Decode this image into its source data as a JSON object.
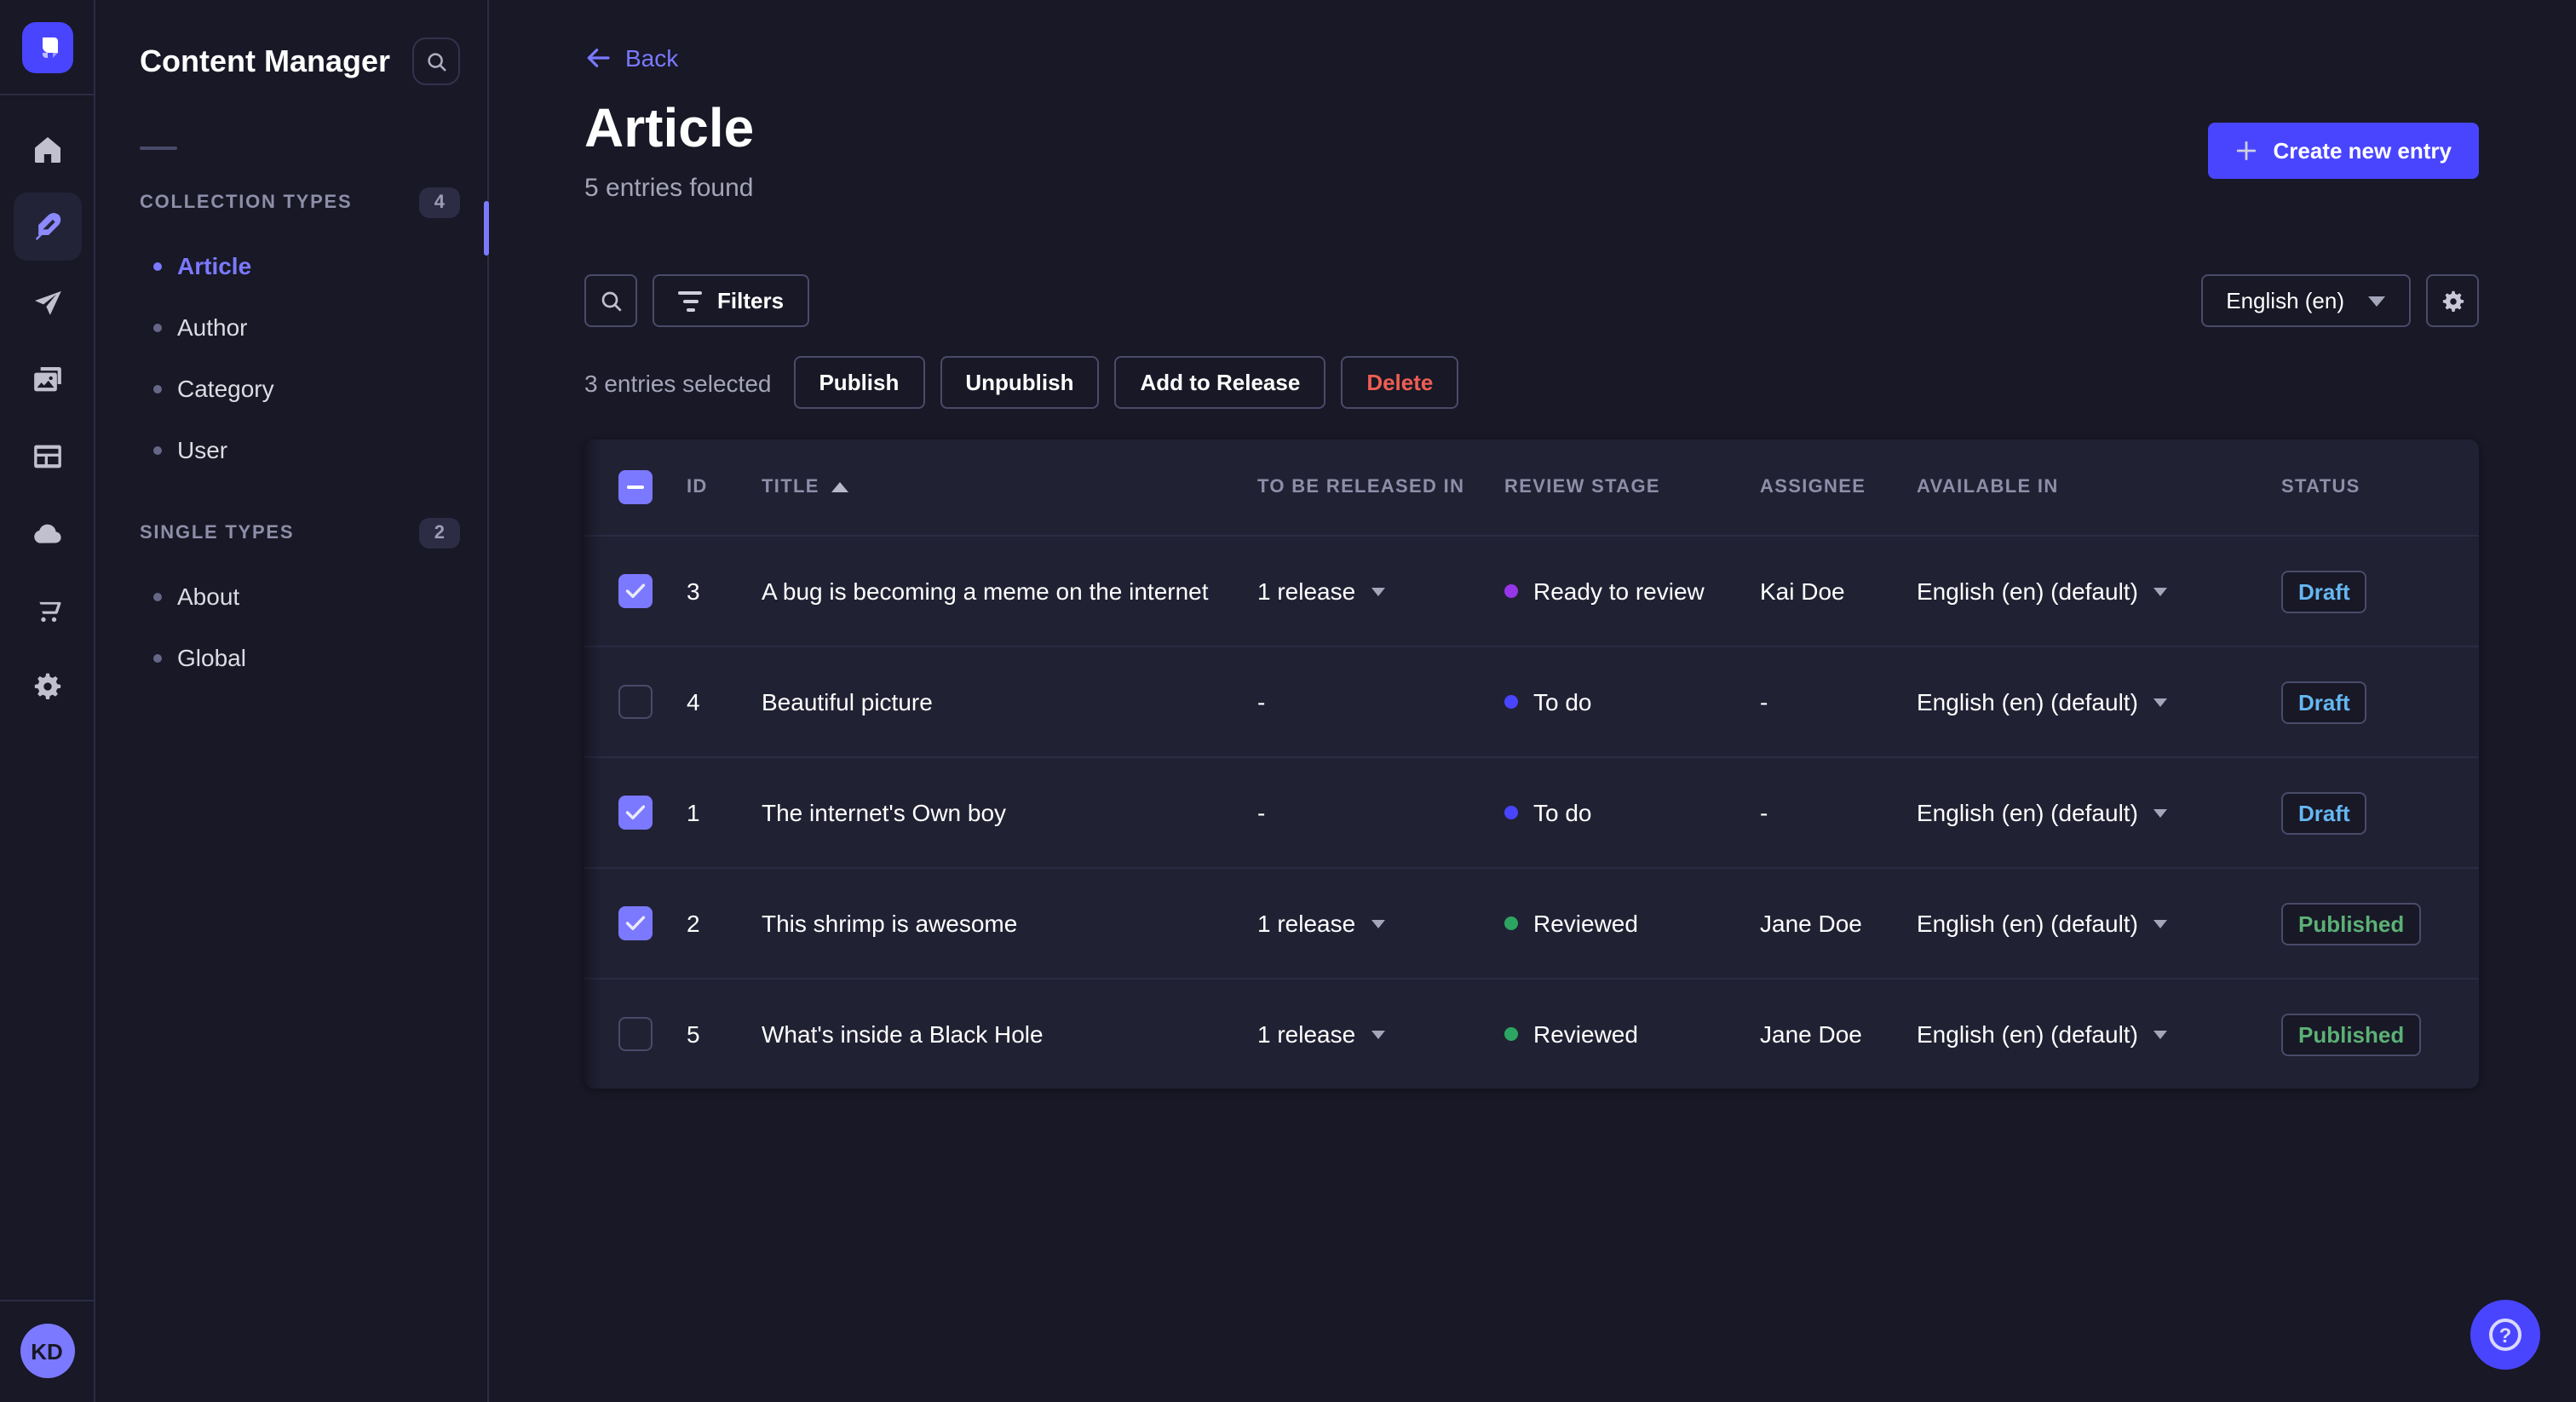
{
  "nav_rail": {
    "items": [
      {
        "name": "home-icon"
      },
      {
        "name": "content-manager-feather-icon",
        "active": true
      },
      {
        "name": "releases-paper-plane-icon"
      },
      {
        "name": "media-library-images-icon"
      },
      {
        "name": "content-type-builder-layout-icon"
      },
      {
        "name": "cloud-icon"
      },
      {
        "name": "marketplace-cart-icon"
      },
      {
        "name": "settings-gear-icon"
      }
    ],
    "avatar_initials": "KD"
  },
  "sidebar": {
    "title": "Content Manager",
    "sections": [
      {
        "label": "COLLECTION TYPES",
        "count": "4",
        "items": [
          {
            "label": "Article",
            "active": true
          },
          {
            "label": "Author",
            "active": false
          },
          {
            "label": "Category",
            "active": false
          },
          {
            "label": "User",
            "active": false
          }
        ]
      },
      {
        "label": "SINGLE TYPES",
        "count": "2",
        "items": [
          {
            "label": "About",
            "active": false
          },
          {
            "label": "Global",
            "active": false
          }
        ]
      }
    ]
  },
  "header": {
    "back_label": "Back",
    "title": "Article",
    "subtitle": "5 entries found",
    "create_button_label": "Create new entry"
  },
  "toolbar": {
    "filters_label": "Filters",
    "locale_selector": "English (en)"
  },
  "selection": {
    "text": "3 entries selected",
    "publish_label": "Publish",
    "unpublish_label": "Unpublish",
    "add_to_release_label": "Add to Release",
    "delete_label": "Delete"
  },
  "table": {
    "columns": {
      "id": "ID",
      "title": "TITLE",
      "to_be_released_in": "TO BE RELEASED IN",
      "review_stage": "REVIEW STAGE",
      "assignee": "ASSIGNEE",
      "available_in": "AVAILABLE IN",
      "status": "STATUS"
    },
    "sorted_column": "TITLE",
    "rows": [
      {
        "selected": true,
        "id": "3",
        "title": "A bug is becoming a meme on the internet",
        "release": "1 release",
        "has_release_caret": true,
        "stage": "Ready to review",
        "stage_color": "#9736e8",
        "assignee": "Kai Doe",
        "locale": "English (en) (default)",
        "status": "Draft",
        "status_color": "#66b7f1"
      },
      {
        "selected": false,
        "id": "4",
        "title": "Beautiful picture",
        "release": "-",
        "has_release_caret": false,
        "stage": "To do",
        "stage_color": "#4945ff",
        "assignee": "-",
        "locale": "English (en) (default)",
        "status": "Draft",
        "status_color": "#66b7f1"
      },
      {
        "selected": true,
        "id": "1",
        "title": "The internet's Own boy",
        "release": "-",
        "has_release_caret": false,
        "stage": "To do",
        "stage_color": "#4945ff",
        "assignee": "-",
        "locale": "English (en) (default)",
        "status": "Draft",
        "status_color": "#66b7f1"
      },
      {
        "selected": true,
        "id": "2",
        "title": "This shrimp is awesome",
        "release": "1 release",
        "has_release_caret": true,
        "stage": "Reviewed",
        "stage_color": "#2da562",
        "assignee": "Jane Doe",
        "locale": "English (en) (default)",
        "status": "Published",
        "status_color": "#5cb176"
      },
      {
        "selected": false,
        "id": "5",
        "title": "What's inside a Black Hole",
        "release": "1 release",
        "has_release_caret": true,
        "stage": "Reviewed",
        "stage_color": "#2da562",
        "assignee": "Jane Doe",
        "locale": "English (en) (default)",
        "status": "Published",
        "status_color": "#5cb176"
      }
    ]
  },
  "colors": {
    "accent": "#4945ff",
    "link": "#7b79ff",
    "danger": "#ee5e52",
    "draft_text": "#66b7f1",
    "published_text": "#5cb176"
  },
  "help": {
    "question_mark": "?"
  }
}
